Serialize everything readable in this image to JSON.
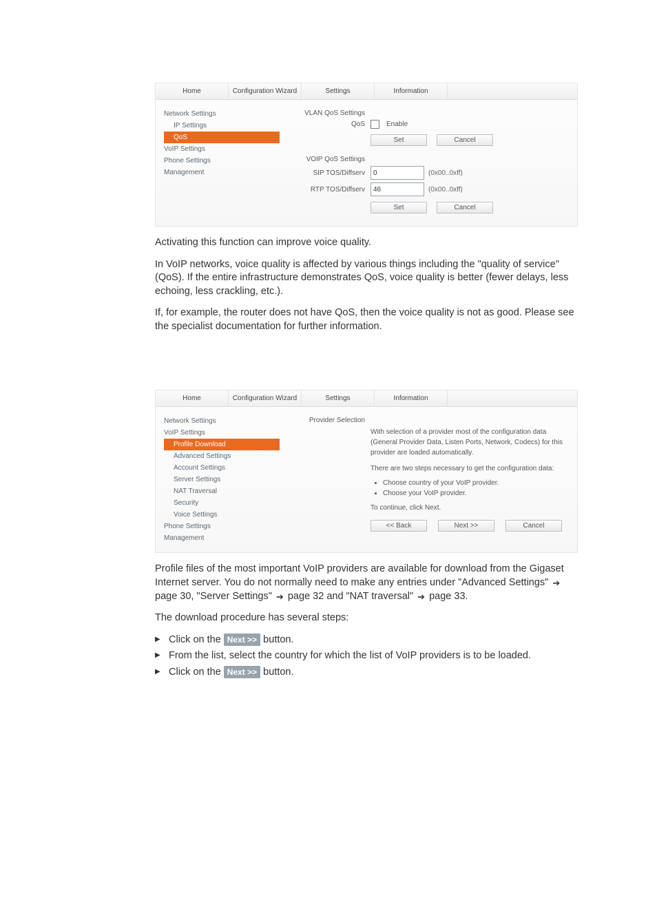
{
  "shot1": {
    "tabs": [
      "Home",
      "Configuration Wizard",
      "Settings",
      "Information"
    ],
    "sidebar": [
      "Network Settings",
      "IP Settings",
      "QoS",
      "VoIP Settings",
      "Phone Settings",
      "Management"
    ],
    "section1": "VLAN QoS Settings",
    "row_qos": "QoS",
    "enable": "Enable",
    "set": "Set",
    "cancel": "Cancel",
    "section2": "VOIP QoS Settings",
    "row_sip": "SIP TOS/Diffserv",
    "row_rtp": "RTP TOS/Diffserv",
    "val_sip": "0",
    "val_rtp": "46",
    "hint": "(0x00..0xff)"
  },
  "text": {
    "p1": "Activating this function can improve voice quality.",
    "p2": "In VoIP networks, voice quality is affected by various things including the \"quality of service\" (QoS). If the entire infrastructure demonstrates QoS, voice quality is better (fewer delays, less echoing, less crackling, etc.).",
    "p3": "If, for example, the router does not have QoS, then the voice quality is not as good. Please see the specialist documentation for further information.",
    "p4a": "Profile files of the most important VoIP providers are available for download from the Gigaset Internet server. You do not normally need to make any entries under \"Advanced Settings\" ",
    "p4b": " page 30, \"Server Settings\" ",
    "p4c": " page 32 and \"NAT traversal\" ",
    "p4d": " page 33.",
    "p5": "The download procedure has several steps:",
    "step1a": "Click on the ",
    "step1b": " button.",
    "step2": "From the list, select the country for which the list of VoIP providers is to be loaded.",
    "step3a": "Click on the ",
    "step3b": " button.",
    "next_badge": "Next >>"
  },
  "shot2": {
    "tabs": [
      "Home",
      "Configuration Wizard",
      "Settings",
      "Information"
    ],
    "sidebar": [
      "Network Settings",
      "VoIP Settings",
      "Profile Download",
      "Advanced Settings",
      "Account Settings",
      "Server Settings",
      "NAT Traversal",
      "Security",
      "Voice Settings",
      "Phone Settings",
      "Management"
    ],
    "heading": "Provider Selection",
    "desc1": "With selection of a provider most of the configuration data (General Provider Data, Listen Ports, Network, Codecs) for this provider are loaded automatically.",
    "desc2": "There are two steps necessary to get the configuration data:",
    "bullet1": "Choose country of your VoIP provider.",
    "bullet2": "Choose your VoIP provider.",
    "desc3": "To continue, click Next.",
    "back": "<< Back",
    "next": "Next >>",
    "cancel": "Cancel"
  }
}
